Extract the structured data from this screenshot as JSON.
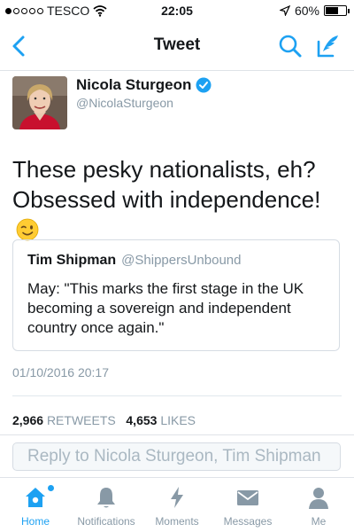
{
  "status_bar": {
    "carrier": "TESCO",
    "time": "22:05",
    "battery_level": "60%"
  },
  "nav": {
    "title": "Tweet"
  },
  "tweet": {
    "author_name": "Nicola Sturgeon",
    "author_handle": "@NicolaSturgeon",
    "text": "These pesky nationalists, eh? Obsessed with independence!",
    "timestamp": "01/10/2016 20:17",
    "retweet_count": "2,966",
    "retweet_label": "RETWEETS",
    "like_count": "4,653",
    "like_label": "LIKES"
  },
  "quoted_tweet": {
    "author_name": "Tim Shipman",
    "author_handle": "@ShippersUnbound",
    "text": "May: \"This marks the first stage in the UK becoming a sovereign and independent country once again.\""
  },
  "reply": {
    "placeholder": "Reply to Nicola Sturgeon, Tim Shipman"
  },
  "tabs": [
    {
      "label": "Home",
      "icon": "home-icon"
    },
    {
      "label": "Notifications",
      "icon": "bell-icon"
    },
    {
      "label": "Moments",
      "icon": "lightning-icon"
    },
    {
      "label": "Messages",
      "icon": "envelope-icon"
    },
    {
      "label": "Me",
      "icon": "person-icon"
    }
  ],
  "colors": {
    "accent": "#1da1f2",
    "muted": "#8899a6"
  }
}
